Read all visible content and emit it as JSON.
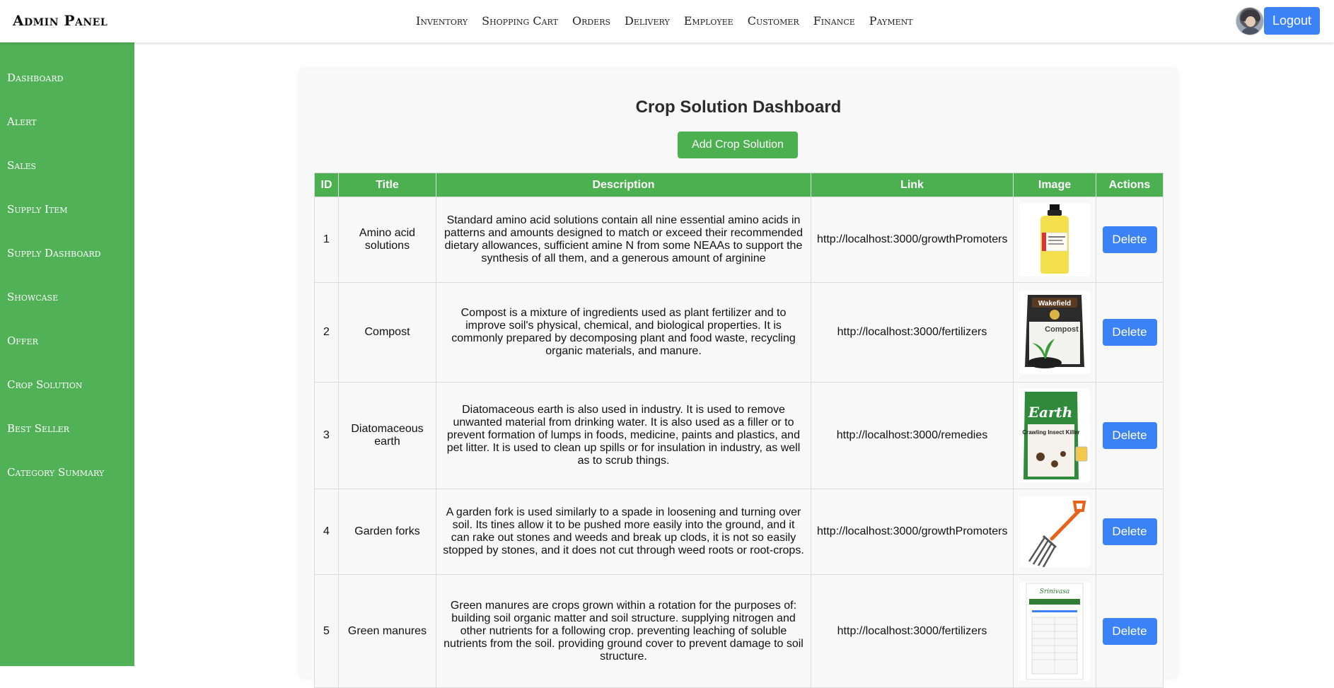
{
  "header": {
    "brand": "Admin Panel",
    "nav": [
      "Inventory",
      "Shopping Cart",
      "Orders",
      "Delivery",
      "Employee",
      "Customer",
      "Finance",
      "Payment"
    ],
    "logout_label": "Logout"
  },
  "sidebar": {
    "items": [
      "Dashboard",
      "Alert",
      "Sales",
      "Supply Item",
      "Supply Dashboard",
      "Showcase",
      "Offer",
      "Crop Solution",
      "Best Seller",
      "Category Summary"
    ]
  },
  "main": {
    "title": "Crop Solution Dashboard",
    "add_label": "Add Crop Solution",
    "columns": [
      "ID",
      "Title",
      "Description",
      "Link",
      "Image",
      "Actions"
    ],
    "delete_label": "Delete",
    "rows": [
      {
        "id": "1",
        "title": "Amino acid solutions",
        "description": "Standard amino acid solutions contain all nine essential amino acids in patterns and amounts designed to match or exceed their recommended dietary allowances, sufficient amine N from some NEAAs to support the synthesis of all them, and a generous amount of arginine",
        "link": "http://localhost:3000/growthPromoters",
        "image": "amino-acid-bottle-image"
      },
      {
        "id": "2",
        "title": "Compost",
        "description": "Compost is a mixture of ingredients used as plant fertilizer and to improve soil's physical, chemical, and biological properties. It is commonly prepared by decomposing plant and food waste, recycling organic materials, and manure.",
        "link": "http://localhost:3000/fertilizers",
        "image": "compost-bag-image",
        "image_text": [
          "Wakefield",
          "Compost"
        ]
      },
      {
        "id": "3",
        "title": "Diatomaceous earth",
        "description": "Diatomaceous earth is also used in industry. It is used to remove unwanted material from drinking water. It is also used as a filler or to prevent formation of lumps in foods, medicine, paints and plastics, and pet litter. It is used to clean up spills or for insulation in industry, as well as to scrub things.",
        "link": "http://localhost:3000/remedies",
        "image": "diatomaceous-earth-bag-image",
        "image_text": [
          "Earth",
          "Crawling Insect Killer"
        ]
      },
      {
        "id": "4",
        "title": "Garden forks",
        "description": "A garden fork is used similarly to a spade in loosening and turning over soil. Its tines allow it to be pushed more easily into the ground, and it can rake out stones and weeds and break up clods, it is not so easily stopped by stones, and it does not cut through weed roots or root-crops.",
        "link": "http://localhost:3000/growthPromoters",
        "image": "garden-fork-image"
      },
      {
        "id": "5",
        "title": "Green manures",
        "description": "Green manures are crops grown within a rotation for the purposes of: building soil organic matter and soil structure. supplying nitrogen and other nutrients for a following crop. preventing leaching of soluble nutrients from the soil. providing ground cover to prevent damage to soil structure.",
        "link": "http://localhost:3000/fertilizers",
        "image": "green-manure-packet-image",
        "image_text": [
          "Srinivasa"
        ]
      }
    ]
  },
  "colors": {
    "sidebar": "#50b156",
    "table_header": "#4caf50",
    "primary_button": "#3b82f6",
    "add_button": "#4caf50"
  }
}
